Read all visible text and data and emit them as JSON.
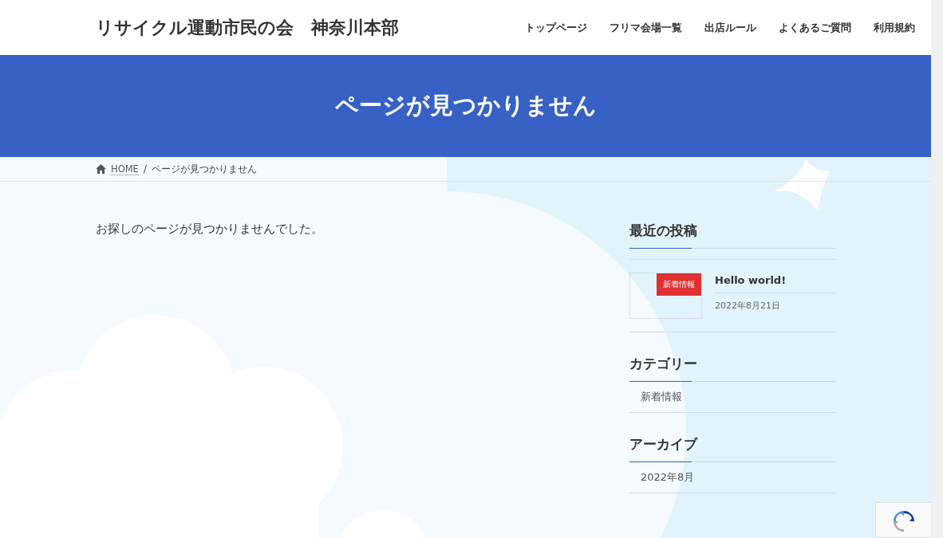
{
  "site_title": "リサイクル運動市民の会　神奈川本部",
  "nav": [
    {
      "label": "トップページ"
    },
    {
      "label": "フリマ会場一覧"
    },
    {
      "label": "出店ルール"
    },
    {
      "label": "よくあるご質問"
    },
    {
      "label": "利用規約"
    }
  ],
  "page_title": "ページが見つかりません",
  "breadcrumb": [
    {
      "label": "HOME",
      "kind": "link"
    },
    {
      "label": "/",
      "kind": "separator"
    },
    {
      "label": "ページが見つかりません",
      "kind": "current"
    }
  ],
  "message": "お探しのページが見つかりませんでした。",
  "sidebar": {
    "recent_posts": {
      "heading": "最近の投稿",
      "posts": [
        {
          "badge": "新着情報",
          "title": "Hello world!",
          "date": "2022年8月21日"
        }
      ]
    },
    "categories": {
      "heading": "カテゴリー",
      "items": [
        {
          "label": "新着情報"
        }
      ]
    },
    "archives": {
      "heading": "アーカイブ",
      "items": [
        {
          "label": "2022年8月"
        }
      ]
    }
  }
}
